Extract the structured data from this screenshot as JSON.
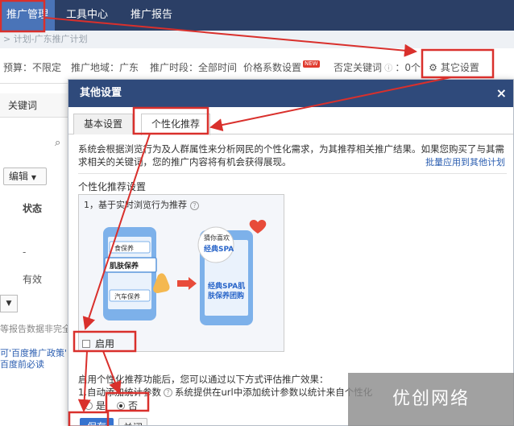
{
  "topnav": {
    "items": [
      {
        "label": "推广管理",
        "active": true
      },
      {
        "label": "工具中心",
        "active": false
      },
      {
        "label": "推广报告",
        "active": false
      }
    ]
  },
  "breadcrumb": "> 计划-广东推广计划",
  "filters": {
    "budget": "预算：不限定",
    "region": "推广地域：广东",
    "period": "推广时段：全部时间",
    "price": "价格系数设置",
    "new_badge": "NEW",
    "negative": "否定关键词",
    "negative_count": "：0个",
    "other": "其它设置"
  },
  "left": {
    "tab": "关键词",
    "edit": "编辑",
    "status": "状态",
    "dash": "-",
    "valid": "有效",
    "note": "等报告数据非完全",
    "link1": "可'百度推广政策'",
    "link2": "百度前必读"
  },
  "modal": {
    "title": "其他设置",
    "close": "×",
    "tabs": [
      "基本设置",
      "个性化推荐"
    ],
    "desc": "系统会根据浏览行为及人群属性来分析网民的个性化需求，为其推荐相关推广结果。如果您购买了与其需求相关的关键词，您的推广内容将有机会获得展现。",
    "batch_link": "批量应用到其他计划",
    "section_title": "个性化推荐设置",
    "box_title": "1，基于实时浏览行为推荐",
    "illus": {
      "left_items": [
        "食保养",
        "肌肤保养",
        "汽车保养"
      ],
      "bubble_top": "猜你喜欢",
      "bubble_mid": "经典SPA",
      "right_text_1": "经典SPA肌",
      "right_text_2": "肤保养团购"
    },
    "enable_label": "启用",
    "after_text": "启用个性化推荐功能后，您可以通过以下方式评估推广效果：",
    "option1": "1.自动添加统计参数",
    "option1_rest": "系统提供在url中添加统计参数以统计来自个性化",
    "radio_yes": "是",
    "radio_no": "否",
    "save": "保存",
    "cancel": "关闭"
  },
  "watermark": "优创网络",
  "colors": {
    "nav_bg": "#2b3f66",
    "nav_active": "#4a74b8",
    "modal_head": "#2f4a7b",
    "annotation_red": "#d9302c",
    "link": "#2a5db0"
  }
}
